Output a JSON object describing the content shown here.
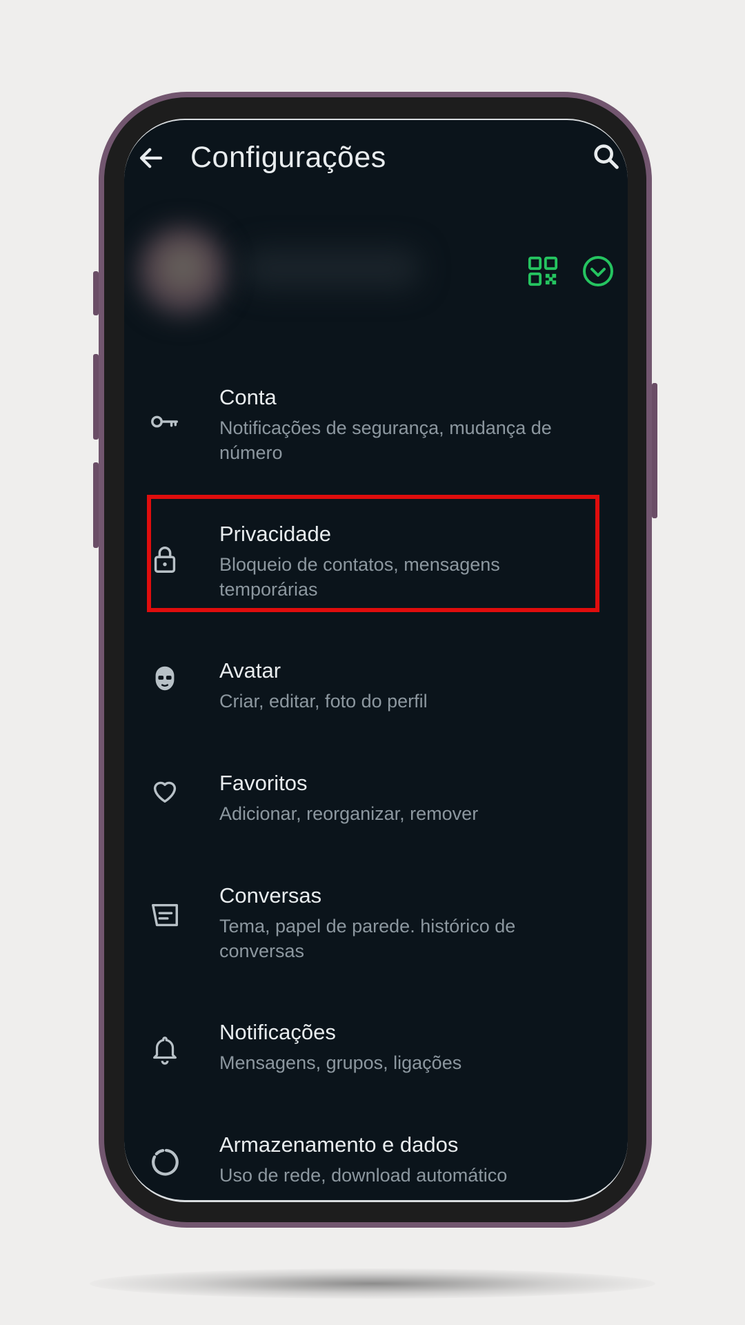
{
  "header": {
    "title": "Configurações",
    "back_icon": "arrow-left-icon",
    "search_icon": "search-icon"
  },
  "profile": {
    "qr_icon": "qr-code-icon",
    "expand_icon": "chevron-down-circle-icon",
    "accent_color": "#25d366"
  },
  "settings": {
    "items": [
      {
        "title": "Conta",
        "subtitle": "Notificações de segurança, mudança de número",
        "icon": "key-icon"
      },
      {
        "title": "Privacidade",
        "subtitle": "Bloqueio de contatos, mensagens temporárias",
        "icon": "lock-icon"
      },
      {
        "title": "Avatar",
        "subtitle": "Criar, editar, foto do perfil",
        "icon": "avatar-icon"
      },
      {
        "title": "Favoritos",
        "subtitle": "Adicionar, reorganizar, remover",
        "icon": "heart-icon"
      },
      {
        "title": "Conversas",
        "subtitle": "Tema, papel de parede. histórico de conversas",
        "icon": "chat-icon"
      },
      {
        "title": "Notificações",
        "subtitle": "Mensagens, grupos, ligações",
        "icon": "bell-icon"
      },
      {
        "title": "Armazenamento e dados",
        "subtitle": "Uso de rede, download automático",
        "icon": "storage-circle-icon"
      }
    ]
  },
  "highlight": {
    "color": "#e00d0d",
    "target": "Privacidade"
  }
}
